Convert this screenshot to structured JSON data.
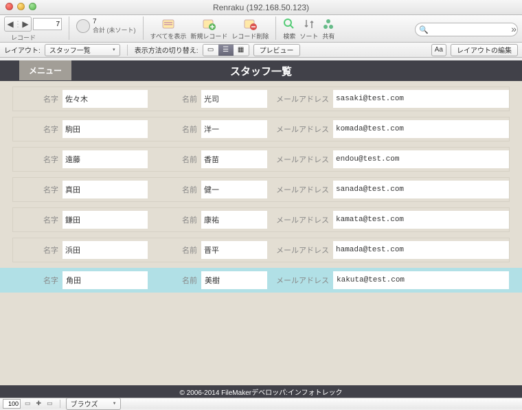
{
  "title": "Renraku (192.168.50.123)",
  "nav": {
    "record_label": "レコード",
    "current": "7",
    "total": "7",
    "total_label": "合計 (未ソート)"
  },
  "toolbar": {
    "show_all": "すべてを表示",
    "new_record": "新規レコード",
    "delete_record": "レコード削除",
    "find": "検索",
    "sort": "ソート",
    "share": "共有"
  },
  "search": {
    "placeholder": ""
  },
  "layoutbar": {
    "layout_label": "レイアウト:",
    "layout_value": "スタッフ一覧",
    "viewmode_label": "表示方法の切り替え:",
    "preview": "プレビュー",
    "aa": "Aa",
    "edit_layout": "レイアウトの編集"
  },
  "header": {
    "menu": "メニュー",
    "title": "スタッフ一覧"
  },
  "labels": {
    "family": "名字",
    "given": "名前",
    "email": "メールアドレス"
  },
  "rows": [
    {
      "family": "佐々木",
      "given": "光司",
      "email": "sasaki@test.com"
    },
    {
      "family": "駒田",
      "given": "洋一",
      "email": "komada@test.com"
    },
    {
      "family": "遠藤",
      "given": "香苗",
      "email": "endou@test.com"
    },
    {
      "family": "真田",
      "given": "健一",
      "email": "sanada@test.com"
    },
    {
      "family": "鎌田",
      "given": "康祐",
      "email": "kamata@test.com"
    },
    {
      "family": "浜田",
      "given": "晋平",
      "email": "hamada@test.com"
    },
    {
      "family": "角田",
      "given": "美樹",
      "email": "kakuta@test.com"
    }
  ],
  "selected_index": 6,
  "footer": "© 2006-2014 FileMakerデベロッパ:インフォトレック",
  "status": {
    "zoom": "100",
    "mode": "ブラウズ"
  }
}
